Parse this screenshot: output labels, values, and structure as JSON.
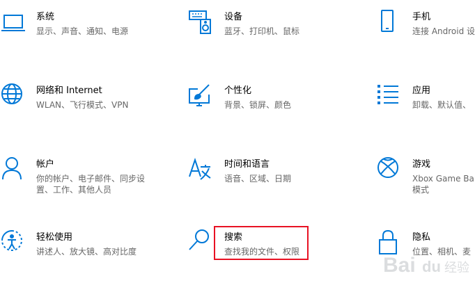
{
  "colors": {
    "accent": "#0078d7",
    "title": "#000000",
    "description": "#666666",
    "highlight": "#e81123"
  },
  "tiles": [
    {
      "id": "system",
      "icon": "laptop-icon",
      "title": "系统",
      "desc_lines": [
        "显示、声音、通知、电源"
      ]
    },
    {
      "id": "devices",
      "icon": "keyboard-speaker-icon",
      "title": "设备",
      "desc_lines": [
        "蓝牙、打印机、鼠标"
      ]
    },
    {
      "id": "phone",
      "icon": "phone-icon",
      "title": "手机",
      "desc_lines": [
        "连接 Android 设"
      ]
    },
    {
      "id": "network",
      "icon": "globe-icon",
      "title": "网络和 Internet",
      "desc_lines": [
        "WLAN、飞行模式、VPN"
      ]
    },
    {
      "id": "personalization",
      "icon": "monitor-brush-icon",
      "title": "个性化",
      "desc_lines": [
        "背景、锁屏、颜色"
      ]
    },
    {
      "id": "apps",
      "icon": "app-list-icon",
      "title": "应用",
      "desc_lines": [
        "卸载、默认值、"
      ]
    },
    {
      "id": "accounts",
      "icon": "person-icon",
      "title": "帐户",
      "desc_lines": [
        "你的帐户、电子邮件、同步设",
        "置、工作、其他人员"
      ]
    },
    {
      "id": "time-language",
      "icon": "language-icon",
      "title": "时间和语言",
      "desc_lines": [
        "语音、区域、日期"
      ]
    },
    {
      "id": "gaming",
      "icon": "xbox-icon",
      "title": "游戏",
      "desc_lines": [
        "Xbox Game Bar",
        "模式"
      ]
    },
    {
      "id": "ease-of-access",
      "icon": "ease-of-access-icon",
      "title": "轻松使用",
      "desc_lines": [
        "讲述人、放大镜、高对比度"
      ]
    },
    {
      "id": "search",
      "icon": "search-icon",
      "title": "搜索",
      "desc_lines": [
        "查找我的文件、权限"
      ]
    },
    {
      "id": "privacy",
      "icon": "lock-icon",
      "title": "隐私",
      "desc_lines": [
        "位置、相机、麦"
      ]
    }
  ],
  "watermark": {
    "text": "Bai du 经验"
  }
}
